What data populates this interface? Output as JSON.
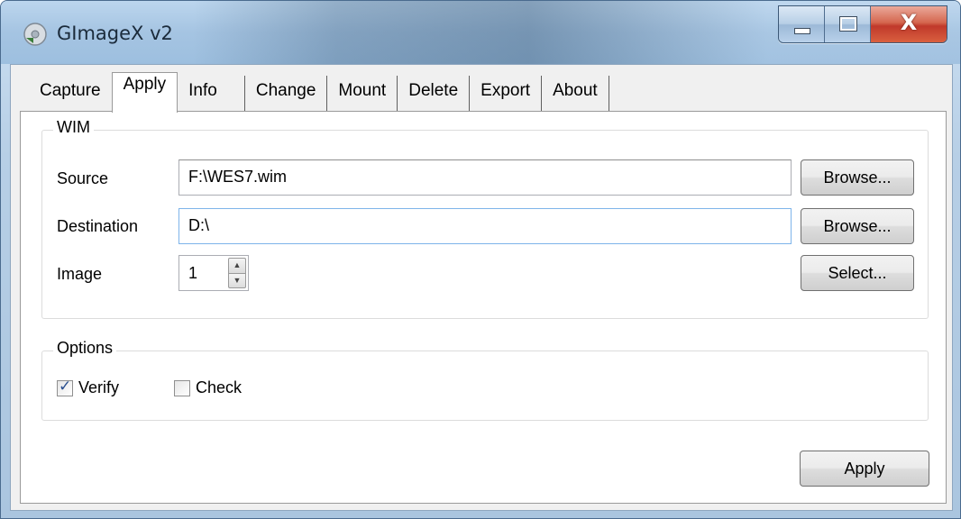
{
  "window": {
    "title": "GImageX v2",
    "close_glyph": "X"
  },
  "tabs": [
    {
      "label": "Capture"
    },
    {
      "label": "Apply"
    },
    {
      "label": "Info"
    },
    {
      "label": "Change"
    },
    {
      "label": "Mount"
    },
    {
      "label": "Delete"
    },
    {
      "label": "Export"
    },
    {
      "label": "About"
    }
  ],
  "wim_group": {
    "title": "WIM",
    "source_label": "Source",
    "source_value": "F:\\WES7.wim",
    "destination_label": "Destination",
    "destination_value": "D:\\",
    "image_label": "Image",
    "image_value": "1",
    "browse_source_label": "Browse...",
    "browse_destination_label": "Browse...",
    "select_label": "Select..."
  },
  "options_group": {
    "title": "Options",
    "verify_label": "Verify",
    "verify_checked": true,
    "check_label": "Check",
    "check_checked": false
  },
  "apply_button_label": "Apply",
  "icons": {
    "spin_up": "▲",
    "spin_down": "▼",
    "checkmark": "✓"
  }
}
